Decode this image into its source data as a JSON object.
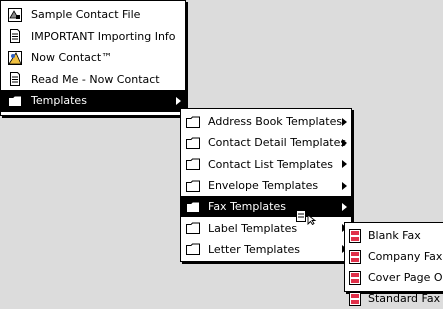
{
  "menu_main": {
    "items": [
      {
        "label": "Sample Contact File",
        "icon": "contact-file-icon"
      },
      {
        "label": "IMPORTANT Importing Info",
        "icon": "document-icon"
      },
      {
        "label": "Now Contact™",
        "icon": "app-icon"
      },
      {
        "label": "Read Me - Now Contact",
        "icon": "document-icon"
      },
      {
        "label": "Templates",
        "icon": "folder-icon",
        "submenu": true,
        "active": true
      }
    ]
  },
  "menu_templates": {
    "items": [
      {
        "label": "Address Book Templates",
        "icon": "folder-icon",
        "submenu": true
      },
      {
        "label": "Contact Detail Templates",
        "icon": "folder-icon",
        "submenu": true
      },
      {
        "label": "Contact List Templates",
        "icon": "folder-icon",
        "submenu": true
      },
      {
        "label": "Envelope Templates",
        "icon": "folder-icon",
        "submenu": true
      },
      {
        "label": "Fax Templates",
        "icon": "folder-icon",
        "submenu": true,
        "active": true
      },
      {
        "label": "Label Templates",
        "icon": "folder-icon",
        "submenu": true
      },
      {
        "label": "Letter Templates",
        "icon": "folder-icon",
        "submenu": true
      }
    ]
  },
  "menu_fax": {
    "items": [
      {
        "label": "Blank Fax",
        "icon": "fax-template-icon"
      },
      {
        "label": "Company Fax",
        "icon": "fax-template-icon"
      },
      {
        "label": "Cover Page Only",
        "icon": "fax-template-icon"
      },
      {
        "label": "Standard Fax",
        "icon": "fax-template-icon"
      }
    ]
  },
  "colors": {
    "menu_bg": "#ffffff",
    "highlight": "#000000",
    "desktop": "#dcdcdc",
    "fax_icon": "#e0304a"
  }
}
